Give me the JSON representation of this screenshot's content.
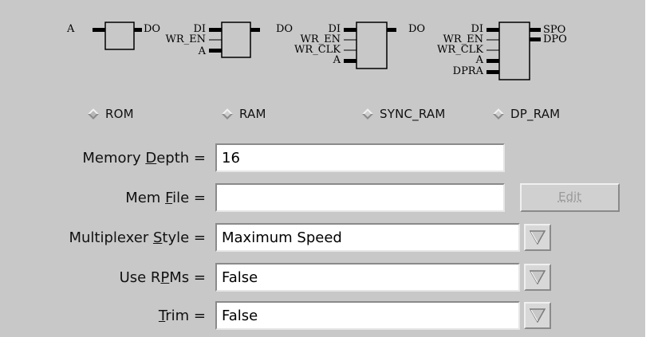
{
  "diagrams": {
    "rom": {
      "in": [
        "A"
      ],
      "out": [
        "DO"
      ]
    },
    "ram": {
      "in": [
        "DI",
        "WR_EN",
        "A"
      ],
      "out": [
        "DO"
      ]
    },
    "sync_ram": {
      "in": [
        "DI",
        "WR_EN",
        "WR_CLK",
        "A"
      ],
      "out": [
        "DO"
      ]
    },
    "dp_ram": {
      "in": [
        "DI",
        "WR_EN",
        "WR_CLK",
        "A",
        "DPRA"
      ],
      "out": [
        "SPO",
        "DPO"
      ]
    }
  },
  "radios": [
    {
      "label": "ROM",
      "selected": true
    },
    {
      "label": "RAM",
      "selected": false
    },
    {
      "label": "SYNC_RAM",
      "selected": false
    },
    {
      "label": "DP_RAM",
      "selected": false
    }
  ],
  "form": {
    "memory_depth": {
      "label_pre": "Memory ",
      "label_mn": "D",
      "label_post": "epth =",
      "value": "16"
    },
    "mem_file": {
      "label_pre": "Mem ",
      "label_mn": "F",
      "label_post": "ile =",
      "value": ""
    },
    "edit_button": "Edit",
    "mux_style": {
      "label_pre": "Multiplexer ",
      "label_mn": "S",
      "label_post": "tyle =",
      "value": "Maximum Speed"
    },
    "use_rpms": {
      "label_pre": "Use R",
      "label_mn": "P",
      "label_post": "Ms =",
      "value": "False"
    },
    "trim": {
      "label_pre": "",
      "label_mn": "T",
      "label_post": "rim =",
      "value": "False"
    }
  },
  "colors": {
    "background": "#c8c8c8",
    "field_bg": "#ffffff",
    "diamond_light": "#f2f2f2",
    "diamond_dark": "#8c8c8c",
    "disabled_text": "#9a9a9a"
  },
  "icons": {
    "radio": "diamond-radio-icon",
    "dropdown": "triangle-down-icon"
  }
}
